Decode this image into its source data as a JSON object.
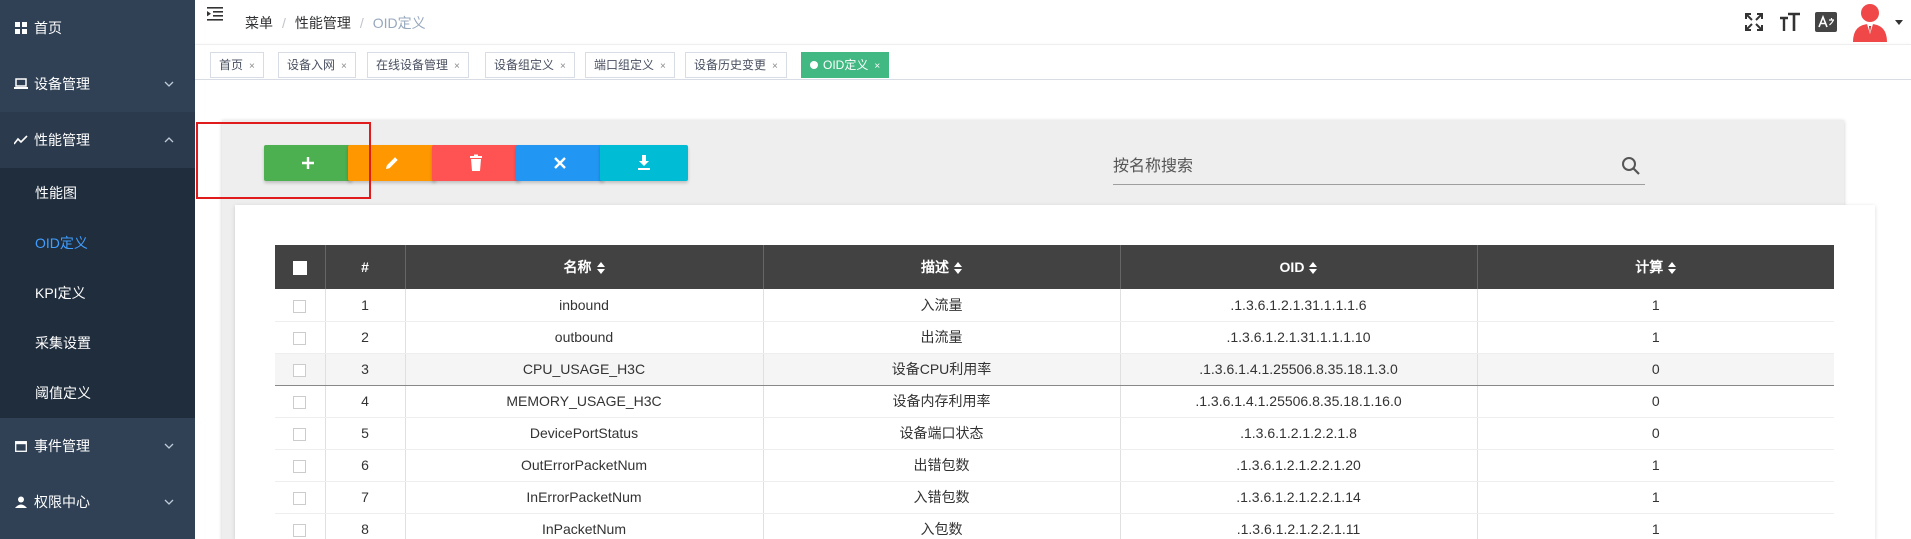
{
  "sidebar": {
    "items": [
      {
        "label": "首页",
        "icon": "dashboard-icon"
      },
      {
        "label": "设备管理",
        "icon": "laptop-icon"
      },
      {
        "label": "性能管理",
        "icon": "chart-line-icon"
      },
      {
        "label": "事件管理",
        "icon": "calendar-icon"
      },
      {
        "label": "权限中心",
        "icon": "user-icon"
      }
    ],
    "submenu": [
      {
        "label": "性能图"
      },
      {
        "label": "OID定义"
      },
      {
        "label": "KPI定义"
      },
      {
        "label": "采集设置"
      },
      {
        "label": "阈值定义"
      }
    ],
    "active_color": "#409eff"
  },
  "breadcrumb": [
    "菜单",
    "性能管理",
    "OID定义"
  ],
  "tags": [
    {
      "label": "首页"
    },
    {
      "label": "设备入网"
    },
    {
      "label": "在线设备管理"
    },
    {
      "label": "设备组定义"
    },
    {
      "label": "端口组定义"
    },
    {
      "label": "设备历史变更"
    },
    {
      "label": "OID定义"
    }
  ],
  "toolbar": {
    "buttons": [
      {
        "name": "add",
        "icon": "plus-icon",
        "color": "#4caf50"
      },
      {
        "name": "edit",
        "icon": "pencil-icon",
        "color": "#ff9800"
      },
      {
        "name": "delete",
        "icon": "trash-icon",
        "color": "#ff5252"
      },
      {
        "name": "cancel",
        "icon": "close-icon",
        "color": "#2196f3"
      },
      {
        "name": "export",
        "icon": "download-icon",
        "color": "#00bcd4"
      }
    ]
  },
  "search": {
    "placeholder": "按名称搜索",
    "value": ""
  },
  "table": {
    "headers": [
      "#",
      "名称",
      "描述",
      "OID",
      "计算"
    ],
    "rows": [
      [
        "1",
        "inbound",
        "入流量",
        ".1.3.6.1.2.1.31.1.1.1.6",
        "1"
      ],
      [
        "2",
        "outbound",
        "出流量",
        ".1.3.6.1.2.1.31.1.1.1.10",
        "1"
      ],
      [
        "3",
        "CPU_USAGE_H3C",
        "设备CPU利用率",
        ".1.3.6.1.4.1.25506.8.35.18.1.3.0",
        "0"
      ],
      [
        "4",
        "MEMORY_USAGE_H3C",
        "设备内存利用率",
        ".1.3.6.1.4.1.25506.8.35.18.1.16.0",
        "0"
      ],
      [
        "5",
        "DevicePortStatus",
        "设备端口状态",
        ".1.3.6.1.2.1.2.2.1.8",
        "0"
      ],
      [
        "6",
        "OutErrorPacketNum",
        "出错包数",
        ".1.3.6.1.2.1.2.2.1.20",
        "1"
      ],
      [
        "7",
        "InErrorPacketNum",
        "入错包数",
        ".1.3.6.1.2.1.2.2.1.14",
        "1"
      ],
      [
        "8",
        "InPacketNum",
        "入包数",
        ".1.3.6.1.2.1.2.2.1.11",
        "1"
      ]
    ]
  }
}
